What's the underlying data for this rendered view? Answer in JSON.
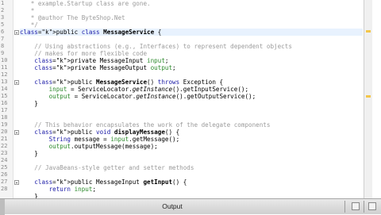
{
  "editor": {
    "lines": [
      {
        "row": 0,
        "html": "   * example.Startup class are gone."
      },
      {
        "row": 1,
        "html": "   *"
      },
      {
        "row": 2,
        "html": "   * @author The ByteShop.Net"
      },
      {
        "row": 3,
        "html": "   */"
      },
      {
        "row": 4,
        "html": "public class MessageService {"
      },
      {
        "row": 5,
        "html": ""
      },
      {
        "row": 6,
        "html": "    // Using abstractions (e.g., Interfaces) to represent dependent objects"
      },
      {
        "row": 7,
        "html": "    // makes for more flexible code"
      },
      {
        "row": 8,
        "html": "    private MessageInput input;"
      },
      {
        "row": 9,
        "html": "    private MessageOutput output;"
      },
      {
        "row": 10,
        "html": ""
      },
      {
        "row": 11,
        "html": "    public MessageService() throws Exception {"
      },
      {
        "row": 12,
        "html": "        input = ServiceLocator.getInstance().getInputService();"
      },
      {
        "row": 13,
        "html": "        output = ServiceLocator.getInstance().getOutputService();"
      },
      {
        "row": 14,
        "html": "    }"
      },
      {
        "row": 15,
        "html": ""
      },
      {
        "row": 16,
        "html": ""
      },
      {
        "row": 17,
        "html": "    // This behavior encapsulates the work of the delegate components"
      },
      {
        "row": 18,
        "html": "    public void displayMessage() {"
      },
      {
        "row": 19,
        "html": "        String message = input.getMessage();"
      },
      {
        "row": 20,
        "html": "        output.outputMessage(message);"
      },
      {
        "row": 21,
        "html": "    }"
      },
      {
        "row": 22,
        "html": ""
      },
      {
        "row": 23,
        "html": "    // JavaBeans-style getter and setter methods"
      },
      {
        "row": 24,
        "html": ""
      },
      {
        "row": 25,
        "html": "    public MessageInput getInput() {"
      },
      {
        "row": 26,
        "html": "        return input;"
      },
      {
        "row": 27,
        "html": "    }"
      }
    ],
    "gutter_numbers": [
      {
        "row": 12,
        "label": "24"
      },
      {
        "row": 13,
        "label": "25"
      },
      {
        "row": 14,
        "label": "26"
      },
      {
        "row": 15,
        "label": "27"
      },
      {
        "row": 16,
        "label": "29"
      },
      {
        "row": 18,
        "label": "30"
      },
      {
        "row": 19,
        "label": "31"
      },
      {
        "row": 20,
        "label": "32"
      },
      {
        "row": 21,
        "label": "33"
      },
      {
        "row": 22,
        "label": "34"
      },
      {
        "row": 23,
        "label": "35"
      },
      {
        "row": 25,
        "label": "37"
      },
      {
        "row": 26,
        "label": "38"
      },
      {
        "row": 27,
        "label": "39"
      }
    ]
  },
  "output_panel": {
    "title": "Output"
  },
  "colors": {
    "comment": "#9b9b9b",
    "keyword": "#1a1aa6",
    "field": "#2c8a2c",
    "current_line": "#e8f2fe"
  }
}
